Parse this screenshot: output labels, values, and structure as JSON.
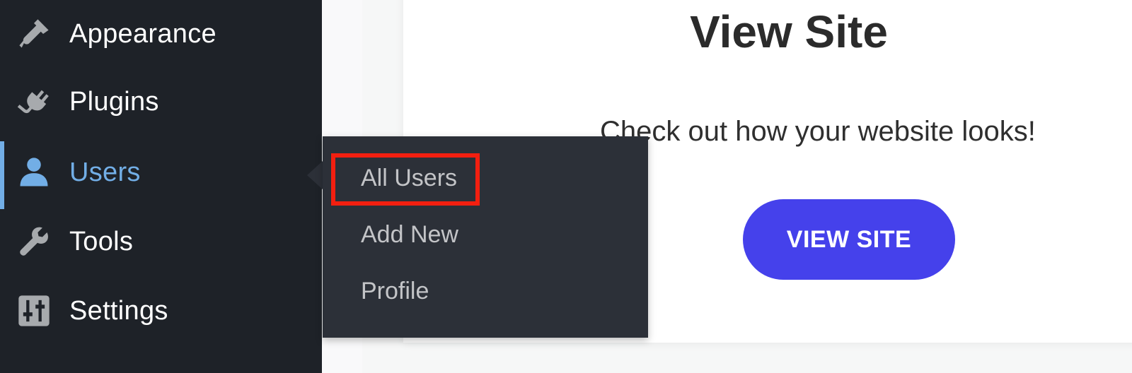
{
  "sidebar": {
    "items": [
      {
        "label": "Appearance",
        "icon": "paintbrush-icon"
      },
      {
        "label": "Plugins",
        "icon": "plug-icon"
      },
      {
        "label": "Users",
        "icon": "user-icon",
        "active": true
      },
      {
        "label": "Tools",
        "icon": "wrench-icon"
      },
      {
        "label": "Settings",
        "icon": "sliders-icon"
      }
    ],
    "active_color": "#72aee6",
    "background": "#1e2228"
  },
  "flyout": {
    "items": [
      {
        "label": "All Users",
        "highlighted": true
      },
      {
        "label": "Add New"
      },
      {
        "label": "Profile"
      }
    ],
    "highlight_color": "#f31f10"
  },
  "main": {
    "title": "View Site",
    "description": "Check out how your website looks!",
    "button_label": "VIEW SITE",
    "button_color": "#4541eb"
  }
}
